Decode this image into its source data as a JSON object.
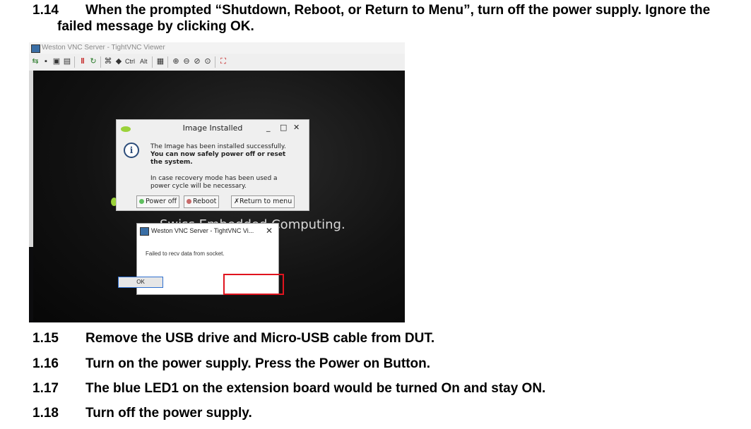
{
  "steps": [
    {
      "num": "1.14",
      "text": "When the prompted “Shutdown, Reboot, or Return to Menu”, turn off the power supply. Ignore the",
      "cont": "failed message by clicking OK."
    },
    {
      "num": "1.15",
      "text": "Remove the USB drive and Micro-USB cable from DUT."
    },
    {
      "num": "1.16",
      "text": "Turn on the power supply. Press the Power on Button."
    },
    {
      "num": "1.17",
      "text": "The blue LED1 on the extension board would be turned On and stay ON."
    },
    {
      "num": "1.18",
      "text": "Turn off the power supply."
    }
  ],
  "viewer": {
    "title": "Weston VNC Server - TightVNC Viewer",
    "toolbar_ctrl": "Ctrl",
    "toolbar_alt": "Alt"
  },
  "image_dialog": {
    "title": "Image Installed",
    "minimize": "_",
    "maximize": "□",
    "close": "✕",
    "info_glyph": "i",
    "line1": "The Image has been installed successfully.",
    "line2": "You can now safely power off or reset",
    "line3": "the system.",
    "line4": "In case recovery mode has been used a",
    "line5": "power cycle will be necessary.",
    "btn_power": "Power off",
    "btn_reboot": "Reboot",
    "btn_return": "Return to menu"
  },
  "background_text": "Swiss Embedded Computing.",
  "error_dialog": {
    "title": "Weston VNC Server - TightVNC Vi...",
    "close": "✕",
    "message": "Failed to recv data from socket.",
    "ok": "OK"
  },
  "colors": {
    "highlight_box": "#e0141e",
    "logo_green": "#9bd23a",
    "ok_border": "#2e6fcf"
  }
}
